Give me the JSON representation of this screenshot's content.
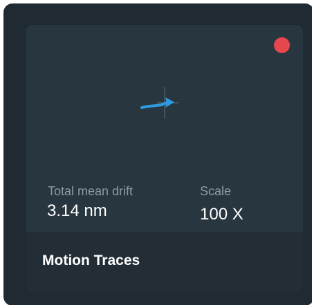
{
  "card": {
    "title": "Motion Traces",
    "stats": {
      "drift_label": "Total mean drift",
      "drift_value": "3.14 nm",
      "scale_label": "Scale",
      "scale_value": "100 X"
    },
    "status_indicator": {
      "color": "#e5474c",
      "icon": "status-dot"
    },
    "trace_color": "#2f9bdf"
  }
}
